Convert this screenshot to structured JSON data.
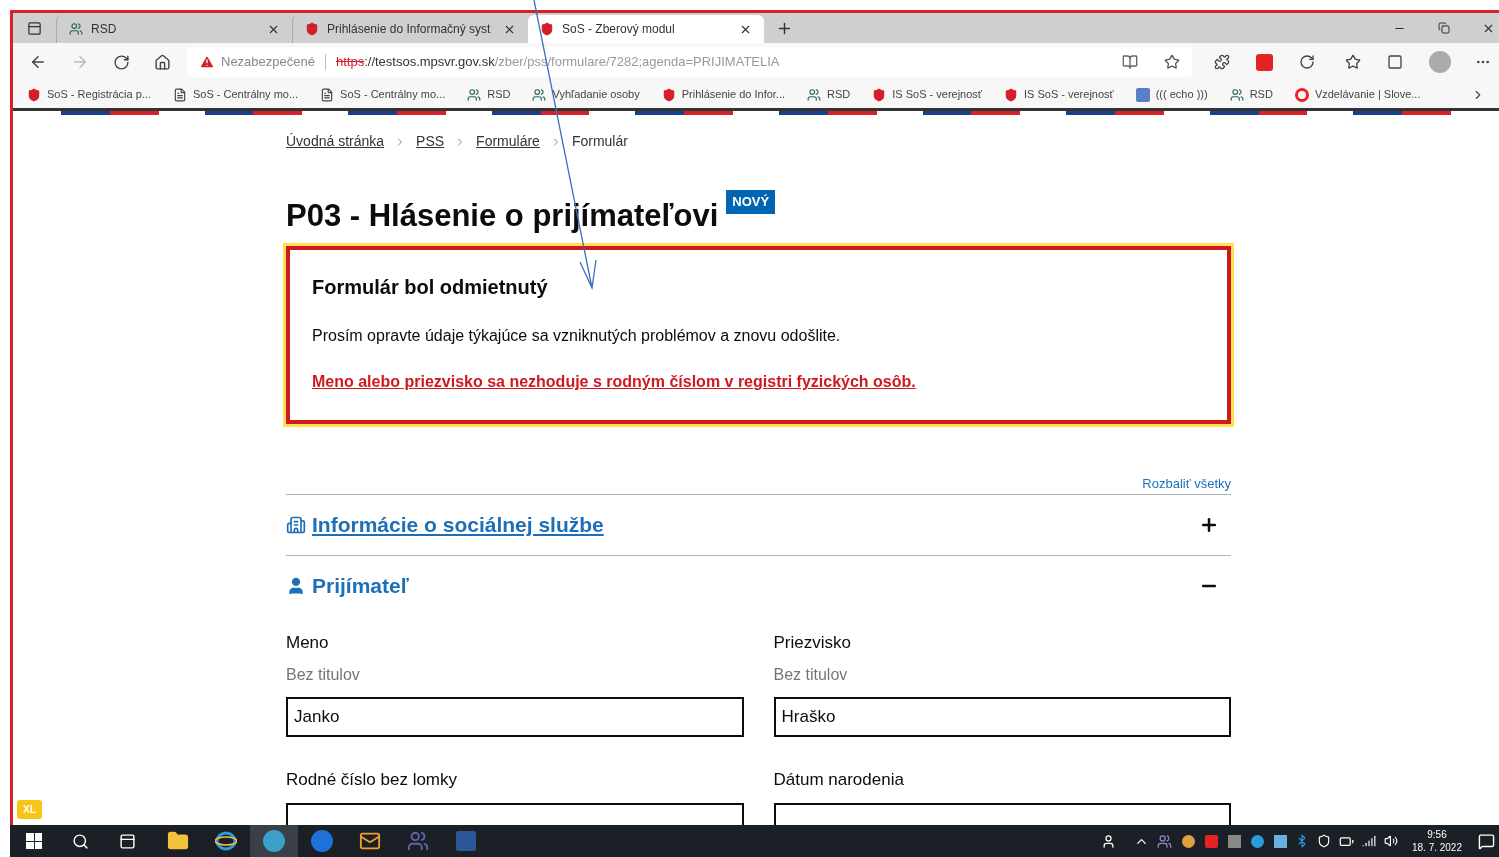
{
  "browser": {
    "tabs": [
      {
        "title": "RSD",
        "kind": "people",
        "selected": false
      },
      {
        "title": "Prihlásenie do Informačný syst",
        "kind": "shield",
        "selected": false
      },
      {
        "title": "SoS - Zberový modul",
        "kind": "shield",
        "selected": true
      }
    ],
    "address": {
      "warning": "Nezabezpečené",
      "scheme": "https",
      "host": "://testsos.mpsvr.gov.sk",
      "path": "/zber/pss/formulare/7282;agenda=PRIJIMATELIA"
    },
    "bookmarks": [
      {
        "title": "SoS - Registrácia p...",
        "kind": "shield"
      },
      {
        "title": "SoS - Centrálny mo...",
        "kind": "page"
      },
      {
        "title": "SoS - Centrálny mo...",
        "kind": "page"
      },
      {
        "title": "RSD",
        "kind": "people"
      },
      {
        "title": "Vyhľadanie osoby",
        "kind": "people"
      },
      {
        "title": "Prihlásenie do Infor...",
        "kind": "shield"
      },
      {
        "title": "RSD",
        "kind": "people"
      },
      {
        "title": "IS SoS - verejnosť",
        "kind": "shield"
      },
      {
        "title": "IS SoS - verejnosť",
        "kind": "shield"
      },
      {
        "title": "((( echo )))",
        "kind": "echo"
      },
      {
        "title": "RSD",
        "kind": "people"
      },
      {
        "title": "Vzdelávanie | Slove...",
        "kind": "ring"
      }
    ]
  },
  "page": {
    "breadcrumbs": [
      {
        "label": "Úvodná stránka",
        "link": true
      },
      {
        "label": "PSS",
        "link": true
      },
      {
        "label": "Formuláre",
        "link": true
      },
      {
        "label": "Formulár",
        "link": false
      }
    ],
    "title": "P03 - Hlásenie o prijímateľovi",
    "badge": "NOVÝ",
    "alert": {
      "title": "Formulár bol odmietnutý",
      "message": "Prosím opravte údaje týkajúce sa vzniknutých problémov a znovu odošlite.",
      "error": "Meno alebo priezvisko sa nezhoduje s rodným číslom v registri fyzických osôb."
    },
    "expand_all": "Rozbaliť všetky",
    "sections": [
      {
        "title": "Informácie o sociálnej službe",
        "kind": "building",
        "expanded": false
      },
      {
        "title": "Prijímateľ",
        "kind": "person",
        "expanded": true
      }
    ],
    "fields": [
      {
        "label": "Meno",
        "hint": "Bez titulov",
        "value": "Janko"
      },
      {
        "label": "Priezvisko",
        "hint": "Bez titulov",
        "value": "Hraško"
      },
      {
        "label": "Rodné číslo bez lomky"
      },
      {
        "label": "Dátum narodenia"
      }
    ]
  },
  "size_badge": "XL",
  "taskbar": {
    "apps": [
      {
        "kind": "explorer",
        "active": false
      },
      {
        "kind": "ie",
        "active": false
      },
      {
        "kind": "edge-beta",
        "active": true
      },
      {
        "kind": "edge",
        "active": false
      },
      {
        "kind": "outlook",
        "active": false
      },
      {
        "kind": "teams",
        "active": false
      },
      {
        "kind": "word",
        "active": false
      }
    ],
    "time": "9:56",
    "date": "18. 7. 2022"
  }
}
